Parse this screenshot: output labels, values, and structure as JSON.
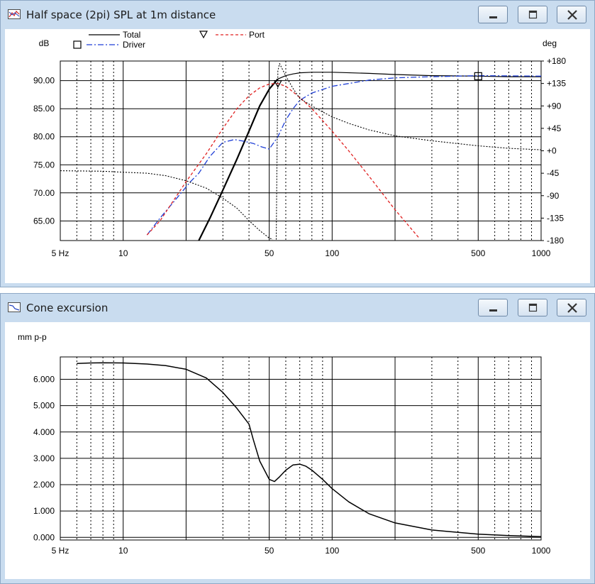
{
  "windows": {
    "spl": {
      "title": "Half space (2pi) SPL at 1m distance",
      "y_unit": "dB",
      "y2_unit": "deg"
    },
    "excursion": {
      "title": "Cone excursion",
      "y_unit": "mm p-p"
    }
  },
  "icons": {
    "title_icon": "graph-window-icon",
    "minimize": "minimize-icon",
    "maximize": "maximize-icon",
    "close": "close-icon",
    "marker_square": "square-marker-icon",
    "marker_triangle": "triangle-marker-icon"
  },
  "colors": {
    "total": "#000000",
    "driver": "#1f3fd6",
    "port": "#e02020",
    "phase": "#000000",
    "titlebar": "#c9dcef"
  },
  "chart_data": [
    {
      "type": "line",
      "title": "Half space (2pi) SPL at 1m distance",
      "xlabel": "",
      "ylabel": "dB",
      "y2label": "deg",
      "x_scale": "log",
      "xlim": [
        5,
        1000
      ],
      "ylim": [
        61.5,
        93.5
      ],
      "y2lim": [
        -180,
        180
      ],
      "x_ticks": [
        {
          "v": 5,
          "label": "5 Hz"
        },
        {
          "v": 10,
          "label": "10"
        },
        {
          "v": 50,
          "label": "50"
        },
        {
          "v": 100,
          "label": "100"
        },
        {
          "v": 500,
          "label": "500"
        },
        {
          "v": 1000,
          "label": "1000"
        }
      ],
      "y_ticks": [
        {
          "v": 65,
          "label": "65.00"
        },
        {
          "v": 70,
          "label": "70.00"
        },
        {
          "v": 75,
          "label": "75.00"
        },
        {
          "v": 80,
          "label": "80.00"
        },
        {
          "v": 85,
          "label": "85.00"
        },
        {
          "v": 90,
          "label": "90.00"
        }
      ],
      "y2_ticks": [
        {
          "v": -180,
          "label": "-180"
        },
        {
          "v": -135,
          "label": "-135"
        },
        {
          "v": -90,
          "label": "-90"
        },
        {
          "v": -45,
          "label": "-45"
        },
        {
          "v": 0,
          "label": "+0"
        },
        {
          "v": 45,
          "label": "+45"
        },
        {
          "v": 90,
          "label": "+90"
        },
        {
          "v": 135,
          "label": "+135"
        },
        {
          "v": 180,
          "label": "+180"
        }
      ],
      "legend": [
        {
          "name": "Total",
          "style": "solid",
          "color": "#000000"
        },
        {
          "name": "Driver",
          "style": "dashdot",
          "color": "#1f3fd6"
        },
        {
          "name": "Port",
          "style": "dashed",
          "color": "#e02020"
        }
      ],
      "series": [
        {
          "name": "Total",
          "axis": "left",
          "style": "solid",
          "color": "#000000",
          "width": 2.2,
          "x": [
            23,
            26,
            30,
            35,
            40,
            45,
            50,
            55
          ],
          "y": [
            61.5,
            65.5,
            70.5,
            76,
            81,
            85.5,
            88.5,
            90.3
          ]
        },
        {
          "name": "Total",
          "axis": "left",
          "style": "solid",
          "color": "#000000",
          "width": 1.2,
          "x": [
            55,
            60,
            65,
            70,
            80,
            100,
            150,
            200,
            300,
            500,
            700,
            1000
          ],
          "y": [
            90.3,
            90.9,
            91.2,
            91.4,
            91.5,
            91.5,
            91.3,
            91.1,
            90.9,
            90.8,
            90.7,
            90.7
          ]
        },
        {
          "name": "Driver",
          "axis": "left",
          "style": "dashdot",
          "color": "#1f3fd6",
          "width": 1.3,
          "x": [
            13,
            15,
            18,
            21,
            23,
            26,
            30,
            34,
            38,
            42,
            46,
            50,
            55,
            60,
            65,
            70,
            80,
            100,
            150,
            200,
            300,
            500,
            1000
          ],
          "y": [
            62.5,
            65.5,
            69,
            72,
            73.5,
            76.5,
            79,
            79.5,
            79.2,
            78.8,
            78.2,
            77.8,
            80,
            83,
            85,
            86.5,
            87.8,
            89,
            90.1,
            90.5,
            90.7,
            90.9,
            90.8
          ]
        },
        {
          "name": "Port",
          "axis": "left",
          "style": "dashed",
          "color": "#e02020",
          "width": 1.3,
          "x": [
            13,
            15,
            20,
            25,
            30,
            35,
            40,
            45,
            50,
            55,
            60,
            65,
            70,
            80,
            100,
            120,
            150,
            200,
            260
          ],
          "y": [
            62.5,
            65,
            72,
            77,
            81.5,
            85,
            87.3,
            88.7,
            89.4,
            89.5,
            89,
            88,
            87,
            85,
            81,
            77.5,
            73,
            67,
            62
          ]
        },
        {
          "name": "",
          "axis": "right",
          "style": "dotted",
          "color": "#000000",
          "width": 1.1,
          "x": [
            5,
            8,
            10,
            13,
            16,
            20,
            25,
            30,
            35,
            40,
            45,
            50,
            52
          ],
          "y": [
            -40,
            -41,
            -43,
            -45,
            -50,
            -60,
            -75,
            -95,
            -115,
            -140,
            -160,
            -175,
            -178
          ]
        },
        {
          "name": "",
          "axis": "right",
          "style": "dotted",
          "color": "#000000",
          "width": 1.1,
          "x": [
            54,
            55,
            56,
            60,
            65,
            70,
            80,
            90,
            100,
            120,
            150,
            200,
            300,
            500,
            700,
            1000
          ],
          "y": [
            -178,
            160,
            175,
            150,
            125,
            105,
            90,
            78,
            68,
            55,
            42,
            30,
            20,
            10,
            5,
            2
          ]
        }
      ],
      "markers": [
        {
          "type": "square",
          "x": 500,
          "y": 90.8
        },
        {
          "type": "triangle",
          "x": 55,
          "y": 89.5
        }
      ]
    },
    {
      "type": "line",
      "title": "Cone excursion",
      "xlabel": "",
      "ylabel": "mm p-p",
      "x_scale": "log",
      "xlim": [
        5,
        1000
      ],
      "ylim": [
        -0.1,
        6.85
      ],
      "x_ticks": [
        {
          "v": 5,
          "label": "5 Hz"
        },
        {
          "v": 10,
          "label": "10"
        },
        {
          "v": 50,
          "label": "50"
        },
        {
          "v": 100,
          "label": "100"
        },
        {
          "v": 500,
          "label": "500"
        },
        {
          "v": 1000,
          "label": "1000"
        }
      ],
      "y_ticks": [
        {
          "v": 0,
          "label": "0.000"
        },
        {
          "v": 1,
          "label": "1.000"
        },
        {
          "v": 2,
          "label": "2.000"
        },
        {
          "v": 3,
          "label": "3.000"
        },
        {
          "v": 4,
          "label": "4.000"
        },
        {
          "v": 5,
          "label": "5.000"
        },
        {
          "v": 6,
          "label": "6.000"
        }
      ],
      "series": [
        {
          "name": "",
          "axis": "left",
          "style": "solid",
          "color": "#000000",
          "width": 1.5,
          "x": [
            6,
            7,
            8,
            10,
            13,
            16,
            20,
            25,
            30,
            35,
            40,
            42,
            45,
            50,
            53,
            56,
            60,
            65,
            70,
            75,
            80,
            90,
            100,
            120,
            150,
            200,
            300,
            500,
            700,
            1000
          ],
          "y": [
            6.6,
            6.62,
            6.63,
            6.62,
            6.58,
            6.52,
            6.38,
            6.05,
            5.5,
            4.9,
            4.3,
            3.7,
            2.9,
            2.2,
            2.12,
            2.3,
            2.55,
            2.75,
            2.78,
            2.7,
            2.55,
            2.2,
            1.85,
            1.35,
            0.9,
            0.55,
            0.28,
            0.12,
            0.07,
            0.03
          ]
        }
      ]
    }
  ]
}
